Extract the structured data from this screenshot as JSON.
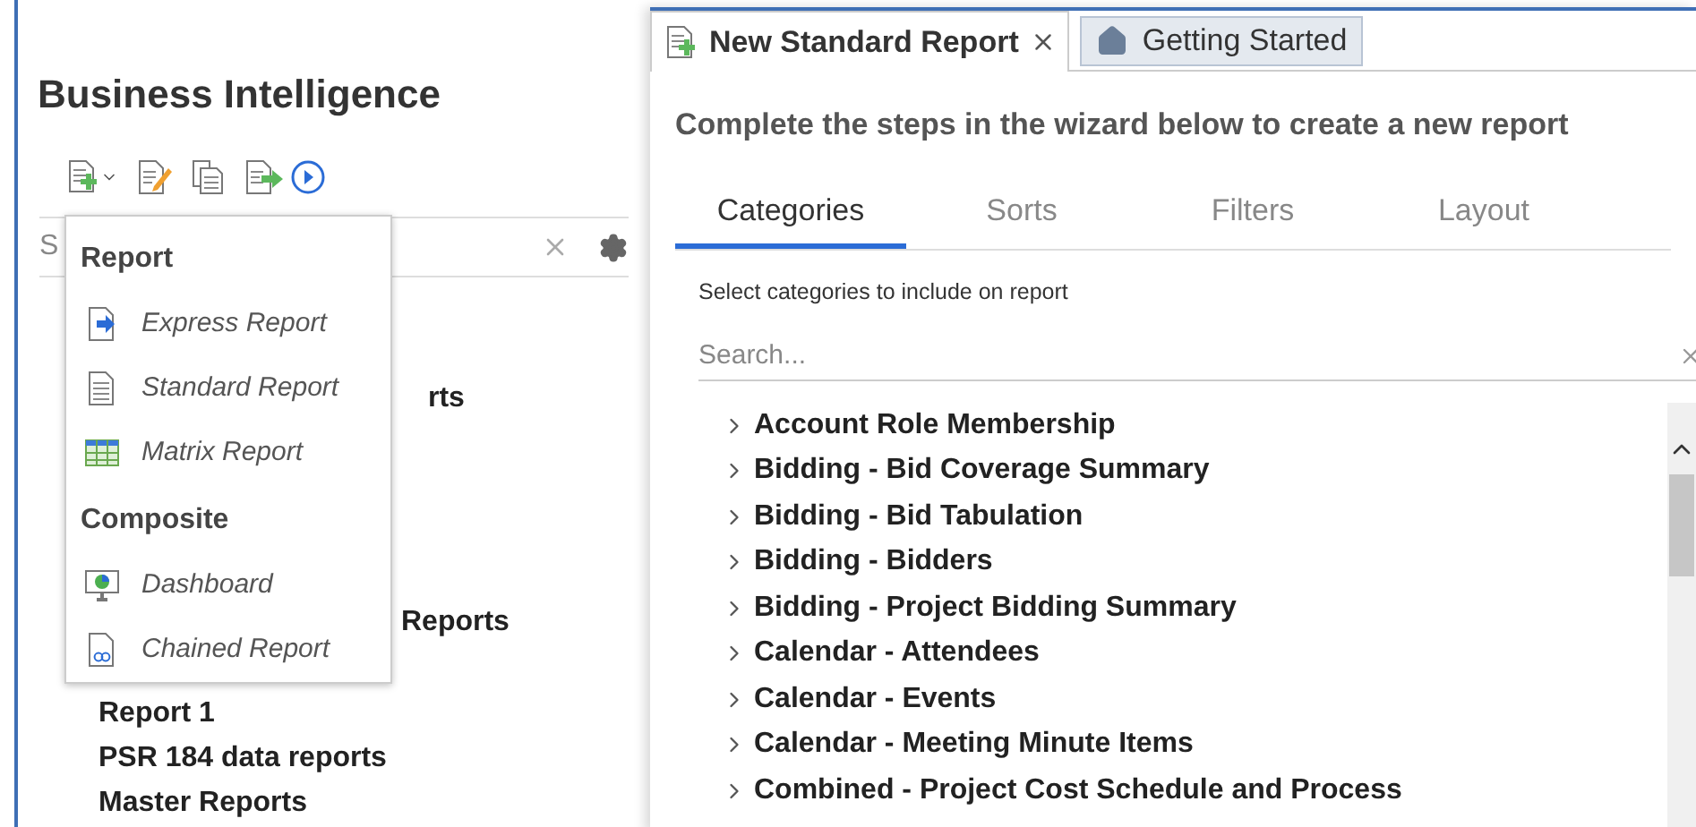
{
  "left_panel": {
    "title": "Business Intelligence",
    "search": {
      "placeholder": "S"
    },
    "list_items": [
      {
        "label": "rts",
        "kind": "fragment"
      },
      {
        "label": "Reports",
        "kind": "fragment"
      },
      {
        "label": "Report 1",
        "kind": "full"
      },
      {
        "label": "PSR 184 data reports",
        "kind": "full"
      },
      {
        "label": "Master Reports",
        "kind": "full"
      }
    ]
  },
  "new_menu": {
    "sections": [
      {
        "heading": "Report",
        "items": [
          {
            "label": "Express Report",
            "kind": "express"
          },
          {
            "label": "Standard Report",
            "kind": "standard"
          },
          {
            "label": "Matrix Report",
            "kind": "matrix"
          }
        ]
      },
      {
        "heading": "Composite",
        "items": [
          {
            "label": "Dashboard",
            "kind": "dashboard"
          },
          {
            "label": "Chained Report",
            "kind": "chained"
          }
        ]
      }
    ]
  },
  "doc_tabs": [
    {
      "label": "New Standard Report",
      "selected": true,
      "kind": "report"
    },
    {
      "label": "Getting Started",
      "selected": false,
      "kind": "home"
    }
  ],
  "wizard": {
    "heading": "Complete the steps in the wizard below to create a new report",
    "steps": [
      {
        "label": "Categories",
        "selected": true
      },
      {
        "label": "Sorts",
        "selected": false
      },
      {
        "label": "Filters",
        "selected": false
      },
      {
        "label": "Layout",
        "selected": false
      }
    ],
    "instruction": "Select categories to include on report",
    "search": {
      "placeholder": "Search..."
    },
    "categories": [
      {
        "label": "Account Role Membership",
        "expanded": false
      },
      {
        "label": "Bidding - Bid Coverage Summary",
        "expanded": false
      },
      {
        "label": "Bidding - Bid Tabulation",
        "expanded": false
      },
      {
        "label": "Bidding - Bidders",
        "expanded": false
      },
      {
        "label": "Bidding - Project Bidding Summary",
        "expanded": false
      },
      {
        "label": "Calendar - Attendees",
        "expanded": false
      },
      {
        "label": "Calendar - Events",
        "expanded": false
      },
      {
        "label": "Calendar - Meeting Minute Items",
        "expanded": false
      },
      {
        "label": "Combined - Project Cost Schedule and Process",
        "expanded": false
      }
    ]
  }
}
